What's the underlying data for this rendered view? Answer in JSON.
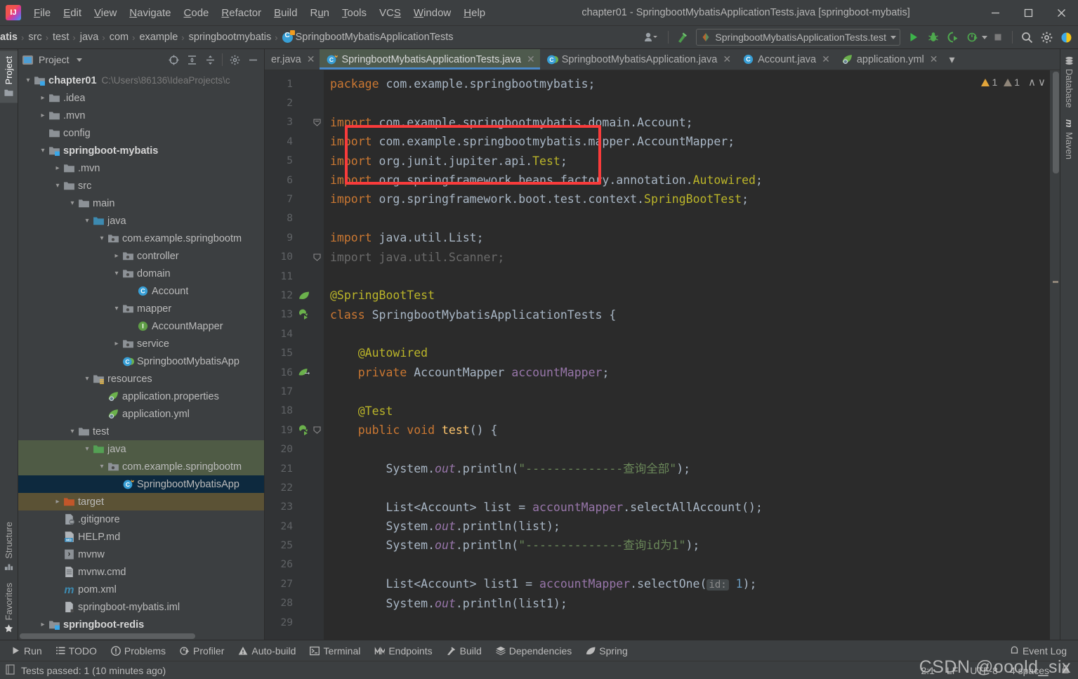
{
  "window": {
    "title": "chapter01 - SpringbootMybatisApplicationTests.java [springboot-mybatis]",
    "minimize": "─",
    "maximize": "□",
    "close": "✕"
  },
  "menubar": {
    "items": [
      {
        "label": "File",
        "mnemonic": "F"
      },
      {
        "label": "Edit",
        "mnemonic": "E"
      },
      {
        "label": "View",
        "mnemonic": "V"
      },
      {
        "label": "Navigate",
        "mnemonic": "N"
      },
      {
        "label": "Code",
        "mnemonic": "C"
      },
      {
        "label": "Refactor",
        "mnemonic": "R"
      },
      {
        "label": "Build",
        "mnemonic": "B"
      },
      {
        "label": "Run",
        "mnemonic": "u"
      },
      {
        "label": "Tools",
        "mnemonic": "T"
      },
      {
        "label": "VCS",
        "mnemonic": "S"
      },
      {
        "label": "Window",
        "mnemonic": "W"
      },
      {
        "label": "Help",
        "mnemonic": "H"
      }
    ]
  },
  "navbar": {
    "crumbs": [
      "atis",
      "src",
      "test",
      "java",
      "com",
      "example",
      "springbootmybatis"
    ],
    "class_crumb": "SpringbootMybatisApplicationTests",
    "separator": "›"
  },
  "toolbar": {
    "run_config": "SpringbootMybatisApplicationTests.test",
    "buttons": [
      {
        "name": "run-button",
        "tooltip": "Run"
      },
      {
        "name": "debug-button",
        "tooltip": "Debug"
      },
      {
        "name": "run-with-coverage-button",
        "tooltip": "Run with Coverage"
      },
      {
        "name": "profiler-button",
        "tooltip": "Profiler"
      },
      {
        "name": "stop-button",
        "tooltip": "Stop"
      },
      {
        "name": "search-everywhere-button",
        "tooltip": "Search Everywhere"
      },
      {
        "name": "settings-button",
        "tooltip": "Settings"
      },
      {
        "name": "updates-button",
        "tooltip": "IDE and Plugin Updates"
      }
    ]
  },
  "left_strip": {
    "top": [
      {
        "label": "Project",
        "active": true
      }
    ],
    "bottom": [
      {
        "label": "Structure",
        "active": false
      },
      {
        "label": "Favorites",
        "active": false
      }
    ]
  },
  "right_strip": {
    "items": [
      {
        "label": "Database"
      },
      {
        "label": "Maven"
      }
    ]
  },
  "project_panel": {
    "title": "Project",
    "actions": [
      "select-opened-file",
      "expand-all",
      "collapse-all",
      "settings",
      "hide"
    ],
    "tree": [
      {
        "indent": 0,
        "arrow": "down",
        "icon": "module",
        "label": "chapter01",
        "bold": true,
        "path": "C:\\Users\\86136\\IdeaProjects\\c"
      },
      {
        "indent": 1,
        "arrow": "right",
        "icon": "folder",
        "label": ".idea"
      },
      {
        "indent": 1,
        "arrow": "right",
        "icon": "folder",
        "label": ".mvn"
      },
      {
        "indent": 1,
        "arrow": "none",
        "icon": "folder",
        "label": "config"
      },
      {
        "indent": 1,
        "arrow": "down",
        "icon": "module",
        "label": "springboot-mybatis",
        "bold": true
      },
      {
        "indent": 2,
        "arrow": "right",
        "icon": "folder",
        "label": ".mvn"
      },
      {
        "indent": 2,
        "arrow": "down",
        "icon": "folder",
        "label": "src"
      },
      {
        "indent": 3,
        "arrow": "down",
        "icon": "folder",
        "label": "main"
      },
      {
        "indent": 4,
        "arrow": "down",
        "icon": "source-root",
        "label": "java"
      },
      {
        "indent": 5,
        "arrow": "down",
        "icon": "package",
        "label": "com.example.springbootm"
      },
      {
        "indent": 6,
        "arrow": "right",
        "icon": "package",
        "label": "controller"
      },
      {
        "indent": 6,
        "arrow": "down",
        "icon": "package",
        "label": "domain"
      },
      {
        "indent": 7,
        "arrow": "none",
        "icon": "class",
        "label": "Account"
      },
      {
        "indent": 6,
        "arrow": "down",
        "icon": "package",
        "label": "mapper"
      },
      {
        "indent": 7,
        "arrow": "none",
        "icon": "interface",
        "label": "AccountMapper"
      },
      {
        "indent": 6,
        "arrow": "right",
        "icon": "package",
        "label": "service"
      },
      {
        "indent": 6,
        "arrow": "none",
        "icon": "spring-class",
        "label": "SpringbootMybatisApp"
      },
      {
        "indent": 4,
        "arrow": "down",
        "icon": "resource-root",
        "label": "resources"
      },
      {
        "indent": 5,
        "arrow": "none",
        "icon": "spring-config",
        "label": "application.properties"
      },
      {
        "indent": 5,
        "arrow": "none",
        "icon": "spring-config",
        "label": "application.yml"
      },
      {
        "indent": 3,
        "arrow": "down",
        "icon": "folder",
        "label": "test"
      },
      {
        "indent": 4,
        "arrow": "down",
        "icon": "test-root",
        "label": "java",
        "highlight": "test"
      },
      {
        "indent": 5,
        "arrow": "down",
        "icon": "package",
        "label": "com.example.springbootm",
        "highlight": "test"
      },
      {
        "indent": 6,
        "arrow": "none",
        "icon": "test-class",
        "label": "SpringbootMybatisApp",
        "selected": true
      },
      {
        "indent": 2,
        "arrow": "right",
        "icon": "target-folder",
        "label": "target",
        "highlight": "target"
      },
      {
        "indent": 2,
        "arrow": "none",
        "icon": "file-ignored",
        "label": ".gitignore"
      },
      {
        "indent": 2,
        "arrow": "none",
        "icon": "markdown",
        "label": "HELP.md"
      },
      {
        "indent": 2,
        "arrow": "none",
        "icon": "script",
        "label": "mvnw"
      },
      {
        "indent": 2,
        "arrow": "none",
        "icon": "file-plain",
        "label": "mvnw.cmd"
      },
      {
        "indent": 2,
        "arrow": "none",
        "icon": "maven",
        "label": "pom.xml"
      },
      {
        "indent": 2,
        "arrow": "none",
        "icon": "iml",
        "label": "springboot-mybatis.iml"
      },
      {
        "indent": 1,
        "arrow": "right",
        "icon": "module",
        "label": "springboot-redis",
        "bold": true
      }
    ]
  },
  "editor_tabs": [
    {
      "label": "er.java",
      "icon": "interface",
      "active": false,
      "truncated": true
    },
    {
      "label": "SpringbootMybatisApplicationTests.java",
      "icon": "test-class",
      "active": true
    },
    {
      "label": "SpringbootMybatisApplication.java",
      "icon": "spring-class",
      "active": false
    },
    {
      "label": "Account.java",
      "icon": "class",
      "active": false
    },
    {
      "label": "application.yml",
      "icon": "spring-config",
      "active": false
    }
  ],
  "inspection_widget": {
    "warnings": "1",
    "weak_warnings": "1",
    "prev": "∧",
    "next": "∨"
  },
  "code": {
    "first_line": 1,
    "lines": [
      {
        "n": 1,
        "gutter": "",
        "html": "<span class='kw'>package</span> com.example.springbootmybatis;"
      },
      {
        "n": 2,
        "gutter": "",
        "html": ""
      },
      {
        "n": 3,
        "gutter": "",
        "fold": "start",
        "html": "<span class='kw'>import</span> com.example.springbootmybatis.domain.Account;"
      },
      {
        "n": 4,
        "gutter": "",
        "html": "<span class='kw'>import</span> com.example.springbootmybatis.mapper.AccountMapper;"
      },
      {
        "n": 5,
        "gutter": "",
        "html": "<span class='kw'>import</span> org.junit.jupiter.api.<span class='ann'>Test</span>;"
      },
      {
        "n": 6,
        "gutter": "",
        "html": "<span class='kw'>import</span> org.springframework.beans.factory.annotation.<span class='ann'>Autowired</span>;"
      },
      {
        "n": 7,
        "gutter": "",
        "html": "<span class='kw'>import</span> org.springframework.boot.test.context.<span class='ann'>SpringBootTest</span>;"
      },
      {
        "n": 8,
        "gutter": "",
        "html": ""
      },
      {
        "n": 9,
        "gutter": "",
        "html": "<span class='kw'>import</span> java.util.List;"
      },
      {
        "n": 10,
        "gutter": "",
        "fold": "end",
        "html": "<span class='grey'>import java.util.Scanner;</span>"
      },
      {
        "n": 11,
        "gutter": "",
        "html": ""
      },
      {
        "n": 12,
        "gutter": "spring-leaf",
        "html": "<span class='ann'>@SpringBootTest</span>"
      },
      {
        "n": 13,
        "gutter": "run-test",
        "html": "<span class='kw'>class</span> SpringbootMybatisApplicationTests {"
      },
      {
        "n": 14,
        "gutter": "",
        "html": ""
      },
      {
        "n": 15,
        "gutter": "",
        "html": "    <span class='ann'>@Autowired</span>"
      },
      {
        "n": 16,
        "gutter": "spring-bean",
        "html": "    <span class='kw'>private</span> AccountMapper <span class='fld'>accountMapper</span>;"
      },
      {
        "n": 17,
        "gutter": "",
        "html": ""
      },
      {
        "n": 18,
        "gutter": "",
        "html": "    <span class='ann'>@Test</span>"
      },
      {
        "n": 19,
        "gutter": "run-test",
        "fold": "method",
        "html": "    <span class='kw'>public</span> <span class='kw'>void</span> <span class='yel'>test</span>() {"
      },
      {
        "n": 20,
        "gutter": "",
        "html": ""
      },
      {
        "n": 21,
        "gutter": "",
        "html": "        System.<span class='stat'>out</span>.println(<span class='str'>\"--------------查询全部\"</span>);"
      },
      {
        "n": 22,
        "gutter": "",
        "html": ""
      },
      {
        "n": 23,
        "gutter": "",
        "html": "        List&lt;Account&gt; list = <span class='fld'>accountMapper</span>.selectAllAccount();"
      },
      {
        "n": 24,
        "gutter": "",
        "html": "        System.<span class='stat'>out</span>.println(list);"
      },
      {
        "n": 25,
        "gutter": "",
        "html": "        System.<span class='stat'>out</span>.println(<span class='str'>\"--------------查询id为1\"</span>);"
      },
      {
        "n": 26,
        "gutter": "",
        "html": ""
      },
      {
        "n": 27,
        "gutter": "",
        "html": "        List&lt;Account&gt; list1 = <span class='fld'>accountMapper</span>.selectOne(<span class='hint'>id:</span> <span class='num'>1</span>);"
      },
      {
        "n": 28,
        "gutter": "",
        "html": "        System.<span class='stat'>out</span>.println(list1);"
      },
      {
        "n": 29,
        "gutter": "",
        "html": ""
      }
    ],
    "annotation_box": {
      "label": "autowired-mapper-highlight",
      "color": "#f93b3b"
    }
  },
  "bottom_bar": {
    "items": [
      {
        "label": "Run",
        "icon": "play-icon"
      },
      {
        "label": "TODO",
        "icon": "list-icon"
      },
      {
        "label": "Problems",
        "icon": "exclamation-icon"
      },
      {
        "label": "Profiler",
        "icon": "profiler-icon"
      },
      {
        "label": "Auto-build",
        "icon": "warning-icon"
      },
      {
        "label": "Terminal",
        "icon": "terminal-icon"
      },
      {
        "label": "Endpoints",
        "icon": "endpoints-icon"
      },
      {
        "label": "Build",
        "icon": "hammer-icon"
      },
      {
        "label": "Dependencies",
        "icon": "layers-icon"
      },
      {
        "label": "Spring",
        "icon": "leaf-icon"
      }
    ],
    "event_log": "Event Log"
  },
  "status_bar": {
    "message": "Tests passed: 1 (10 minutes ago)",
    "caret": "2:1",
    "line_separator": "LF",
    "encoding": "UTF-8",
    "indent": "4 spaces"
  },
  "watermark": "CSDN @ooold_six",
  "colors": {
    "accent_blue": "#4a88c7",
    "annotation_red": "#f93b3b",
    "editor_bg": "#2b2b2b",
    "panel_bg": "#3c3f41",
    "selection_blue": "#0d293e",
    "test_scope_green": "#4f5b45",
    "target_excluded": "#5b5235"
  }
}
